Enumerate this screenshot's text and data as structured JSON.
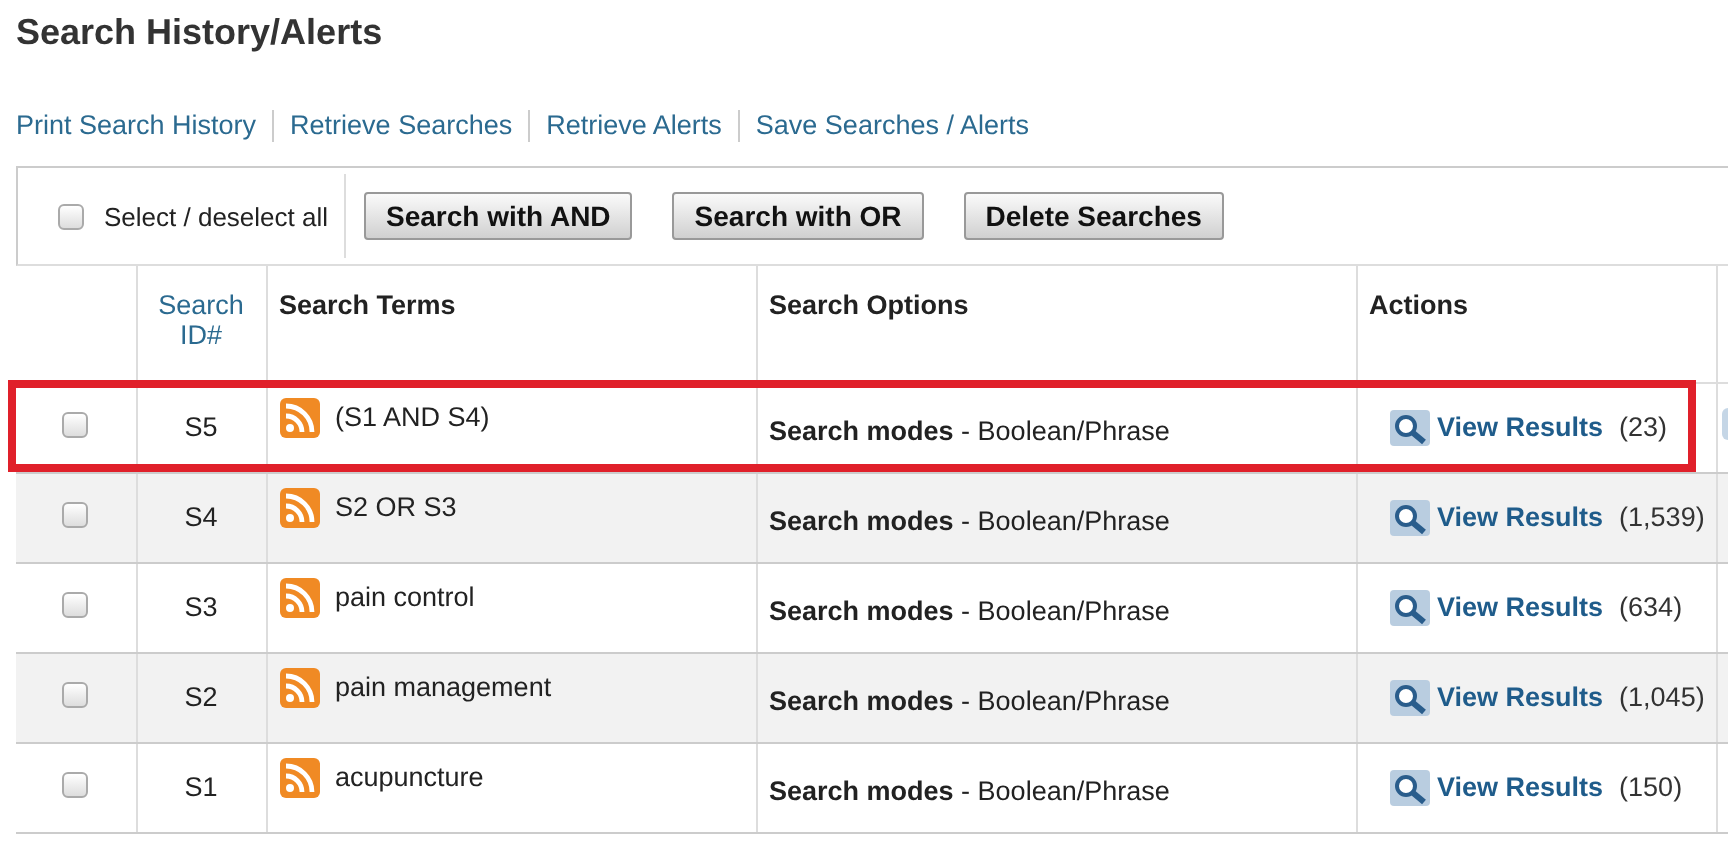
{
  "title": "Search History/Alerts",
  "links": [
    "Print Search History",
    "Retrieve Searches",
    "Retrieve Alerts",
    "Save Searches / Alerts"
  ],
  "toolbar": {
    "select_all": {
      "label": "Select / deselect all",
      "checked": false
    },
    "buttons": [
      "Search with AND",
      "Search with OR",
      "Delete Searches"
    ]
  },
  "table": {
    "columns": [
      "Search ID#",
      "Search Terms",
      "Search Options",
      "Actions"
    ],
    "rows": [
      {
        "id": "S5",
        "terms": "(S1 AND S4)",
        "option_label": "Search modes",
        "option_value": "- Boolean/Phrase",
        "action": "View Results",
        "count": "(23)",
        "checked": false,
        "highlighted": true,
        "extra_icon": true
      },
      {
        "id": "S4",
        "terms": "S2 OR S3",
        "option_label": "Search modes",
        "option_value": "- Boolean/Phrase",
        "action": "View Results",
        "count": "(1,539)",
        "checked": false,
        "highlighted": false,
        "extra_icon": false
      },
      {
        "id": "S3",
        "terms": "pain control",
        "option_label": "Search modes",
        "option_value": "- Boolean/Phrase",
        "action": "View Results",
        "count": "(634)",
        "checked": false,
        "highlighted": false,
        "extra_icon": false
      },
      {
        "id": "S2",
        "terms": "pain management",
        "option_label": "Search modes",
        "option_value": "- Boolean/Phrase",
        "action": "View Results",
        "count": "(1,045)",
        "checked": false,
        "highlighted": false,
        "extra_icon": false
      },
      {
        "id": "S1",
        "terms": "acupuncture",
        "option_label": "Search modes",
        "option_value": "- Boolean/Phrase",
        "action": "View Results",
        "count": "(150)",
        "checked": false,
        "highlighted": false,
        "extra_icon": false
      }
    ]
  }
}
